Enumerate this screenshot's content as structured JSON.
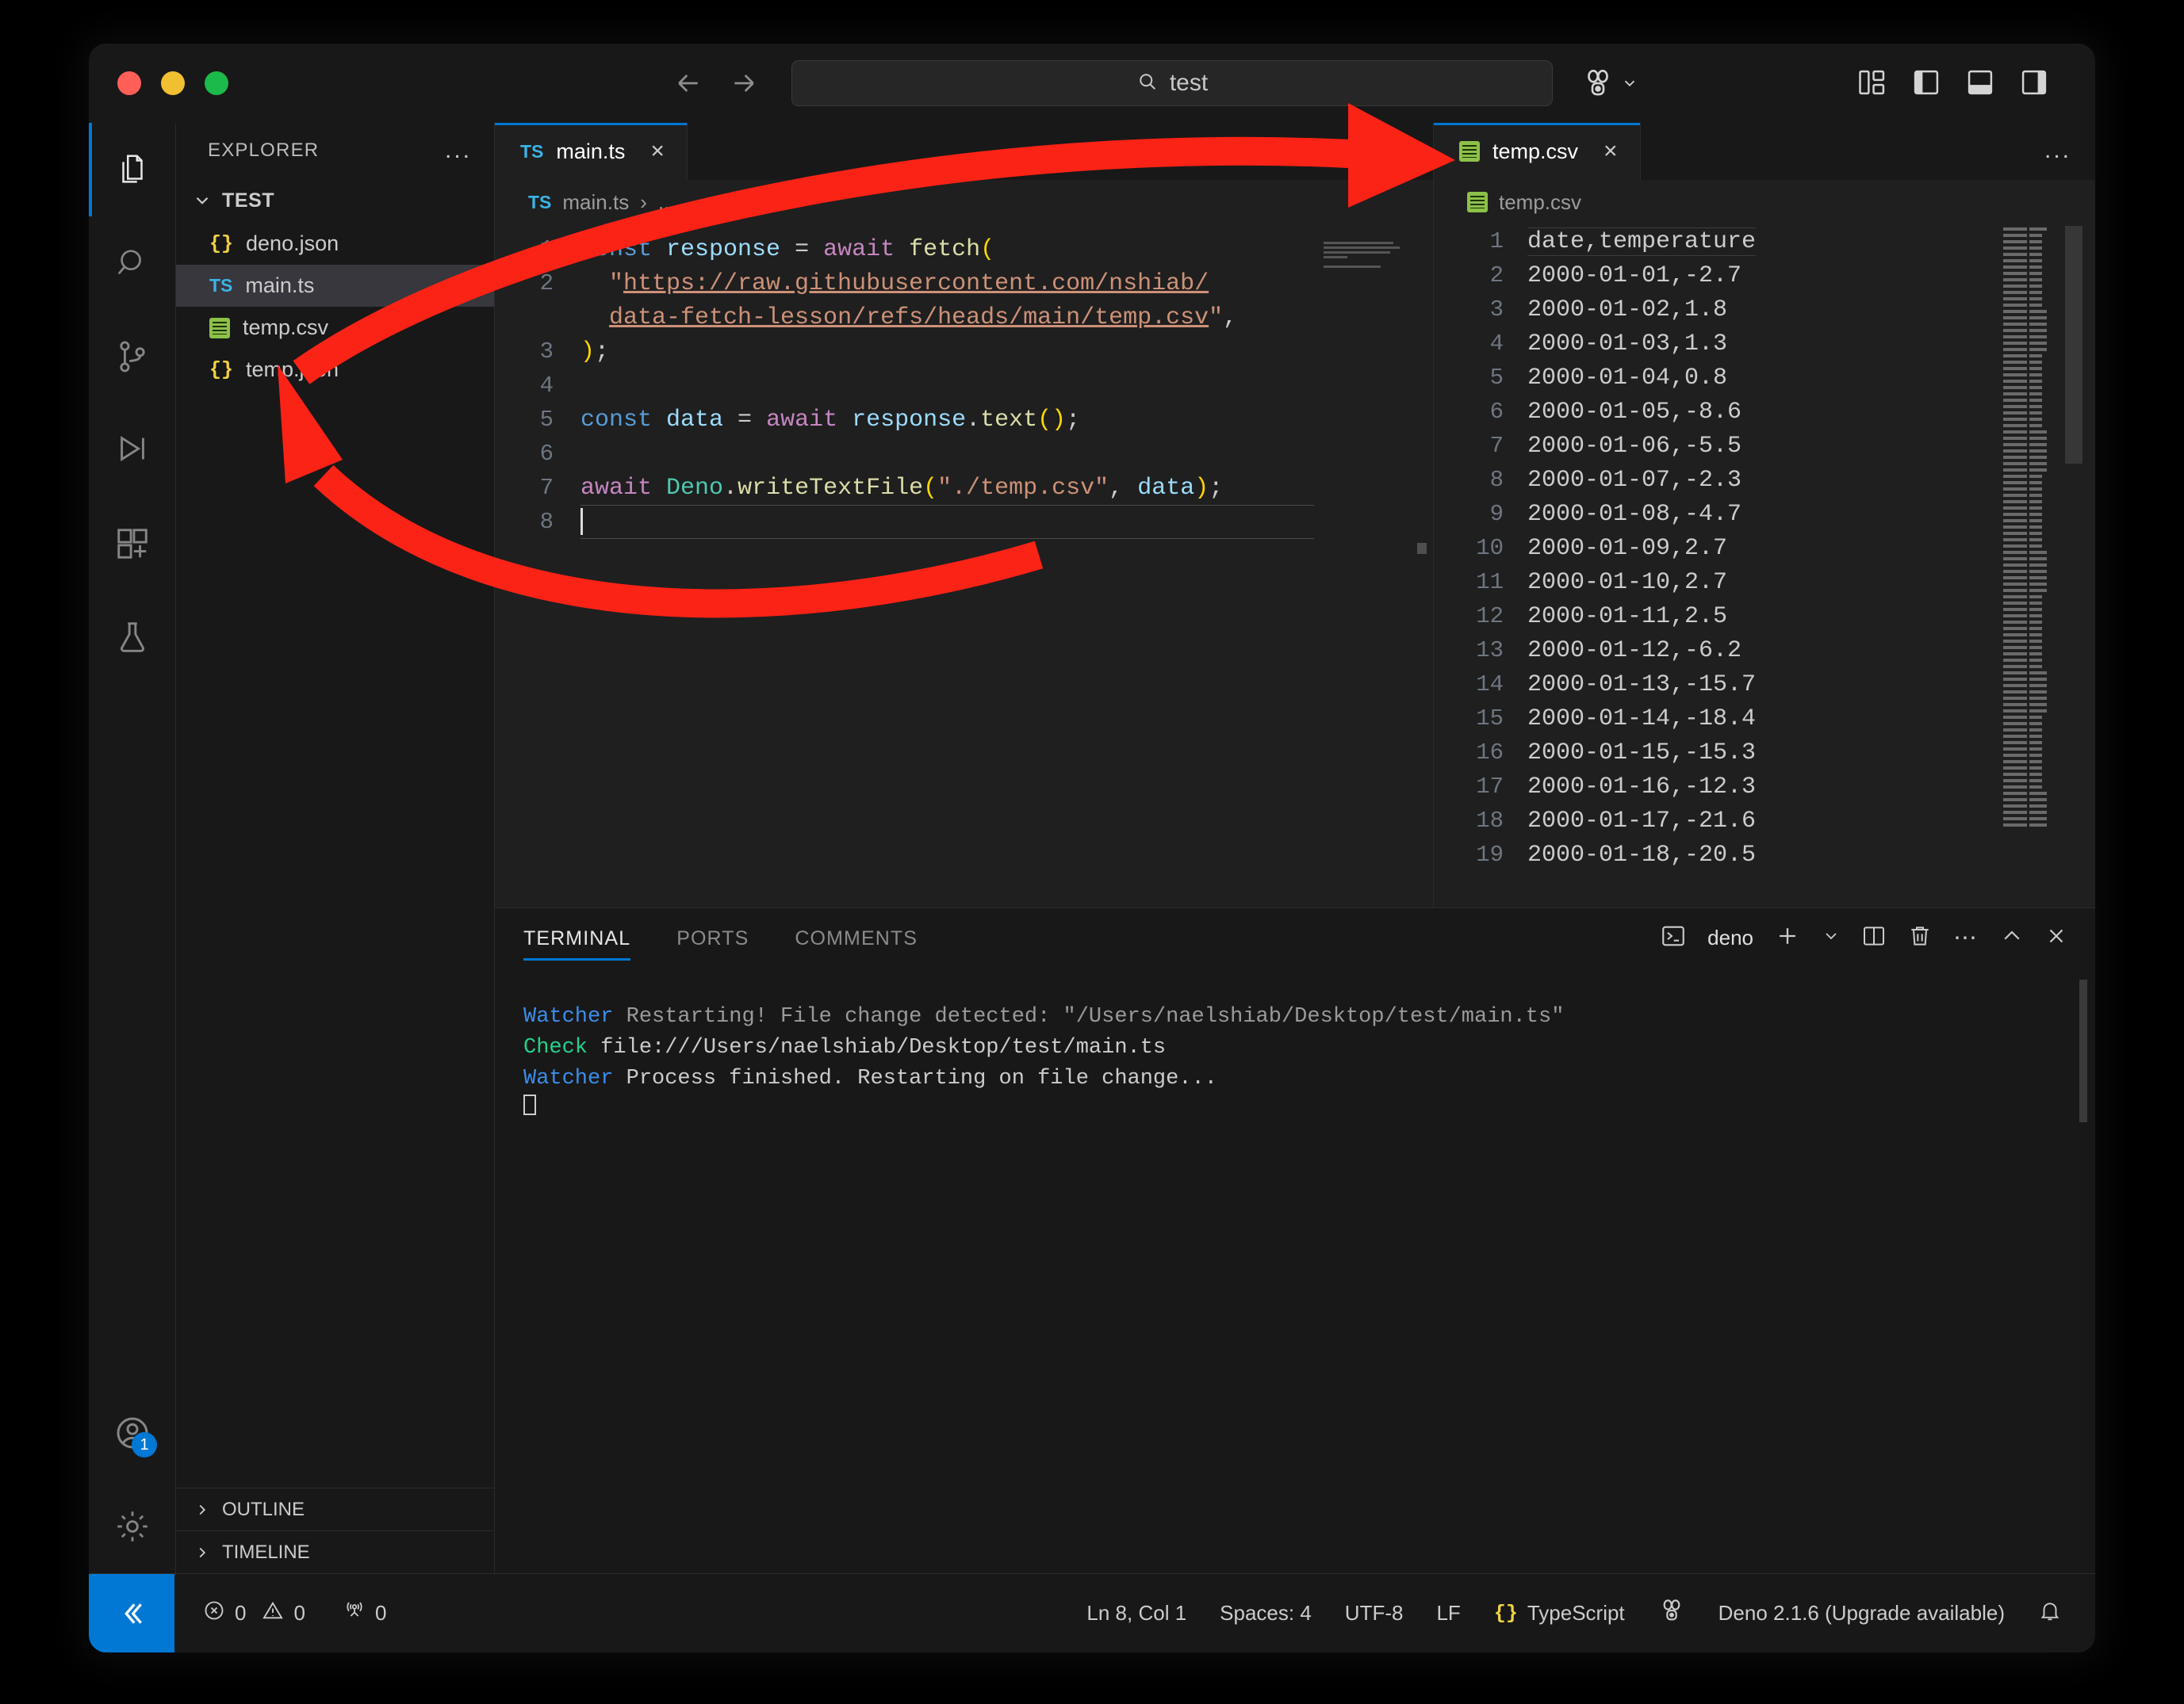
{
  "titlebar": {
    "search_value": "test",
    "search_icon": "search-icon",
    "back_icon": "arrow-left-icon",
    "forward_icon": "arrow-right-icon",
    "account_icon": "remote-explorer-icon",
    "layout_icons": [
      "customize-layout-icon",
      "toggle-primary-sidebar-icon",
      "toggle-panel-icon",
      "toggle-secondary-sidebar-icon"
    ]
  },
  "activitybar": {
    "items": [
      {
        "name": "explorer",
        "icon": "files-icon",
        "active": true
      },
      {
        "name": "search",
        "icon": "search-icon",
        "active": false
      },
      {
        "name": "source-control",
        "icon": "source-control-icon",
        "active": false
      },
      {
        "name": "run-and-debug",
        "icon": "run-debug-icon",
        "active": false
      },
      {
        "name": "extensions",
        "icon": "extensions-icon",
        "active": false
      },
      {
        "name": "testing",
        "icon": "beaker-icon",
        "active": false
      }
    ],
    "bottom": [
      {
        "name": "accounts",
        "icon": "account-icon",
        "badge": "1"
      },
      {
        "name": "manage",
        "icon": "gear-icon",
        "badge": ""
      }
    ]
  },
  "sidebar": {
    "title": "EXPLORER",
    "more_label": "...",
    "section": "TEST",
    "files": [
      {
        "name": "deno.json",
        "icon": "json-icon",
        "selected": false
      },
      {
        "name": "main.ts",
        "icon": "typescript-icon",
        "selected": true
      },
      {
        "name": "temp.csv",
        "icon": "csv-icon",
        "selected": false
      },
      {
        "name": "temp.json",
        "icon": "json-icon",
        "selected": false
      }
    ],
    "panels": [
      {
        "label": "OUTLINE"
      },
      {
        "label": "TIMELINE"
      }
    ]
  },
  "editor_main": {
    "tab": {
      "label": "main.ts",
      "icon": "typescript-icon",
      "close": "×"
    },
    "tabbar_action_icon": "open-changes-icon",
    "breadcrumb": {
      "file": "main.ts",
      "separator": "›",
      "tail": "..."
    },
    "lines": [
      {
        "no": "1",
        "segments": [
          {
            "t": "const ",
            "c": "k-kw"
          },
          {
            "t": "response ",
            "c": "k-var"
          },
          {
            "t": "= ",
            "c": "k-plain"
          },
          {
            "t": "await ",
            "c": "k-await"
          },
          {
            "t": "fetch",
            "c": "k-fn"
          },
          {
            "t": "(",
            "c": "k-paren"
          }
        ]
      },
      {
        "no": "2",
        "segments": [
          {
            "t": "  \"",
            "c": "k-str"
          },
          {
            "t": "https://raw.githubusercontent.com/nshiab/",
            "c": "k-link"
          }
        ]
      },
      {
        "no": "",
        "segments": [
          {
            "t": "  ",
            "c": "k-plain"
          },
          {
            "t": "data-fetch-lesson/refs/heads/main/temp.csv",
            "c": "k-link"
          },
          {
            "t": "\"",
            "c": "k-str"
          },
          {
            "t": ",",
            "c": "k-plain"
          }
        ]
      },
      {
        "no": "3",
        "segments": [
          {
            "t": ")",
            "c": "k-paren"
          },
          {
            "t": ";",
            "c": "k-plain"
          }
        ]
      },
      {
        "no": "4",
        "segments": []
      },
      {
        "no": "5",
        "segments": [
          {
            "t": "const ",
            "c": "k-kw"
          },
          {
            "t": "data ",
            "c": "k-var"
          },
          {
            "t": "= ",
            "c": "k-plain"
          },
          {
            "t": "await ",
            "c": "k-await"
          },
          {
            "t": "response",
            "c": "k-var"
          },
          {
            "t": ".",
            "c": "k-plain"
          },
          {
            "t": "text",
            "c": "k-fn"
          },
          {
            "t": "()",
            "c": "k-paren"
          },
          {
            "t": ";",
            "c": "k-plain"
          }
        ]
      },
      {
        "no": "6",
        "segments": []
      },
      {
        "no": "7",
        "segments": [
          {
            "t": "await ",
            "c": "k-await"
          },
          {
            "t": "Deno",
            "c": "k-ns"
          },
          {
            "t": ".",
            "c": "k-plain"
          },
          {
            "t": "writeTextFile",
            "c": "k-fn"
          },
          {
            "t": "(",
            "c": "k-paren"
          },
          {
            "t": "\"./temp.csv\"",
            "c": "k-str"
          },
          {
            "t": ", ",
            "c": "k-plain"
          },
          {
            "t": "data",
            "c": "k-var"
          },
          {
            "t": ")",
            "c": "k-paren"
          },
          {
            "t": ";",
            "c": "k-plain"
          }
        ]
      },
      {
        "no": "8",
        "segments": [],
        "cursor": true
      }
    ]
  },
  "editor_csv": {
    "tab": {
      "label": "temp.csv",
      "icon": "csv-icon",
      "close": "×"
    },
    "more_label": "...",
    "breadcrumb": {
      "file": "temp.csv",
      "icon": "csv-icon"
    },
    "lines": [
      {
        "no": "1",
        "text": "date,temperature"
      },
      {
        "no": "2",
        "text": "2000-01-01,-2.7"
      },
      {
        "no": "3",
        "text": "2000-01-02,1.8"
      },
      {
        "no": "4",
        "text": "2000-01-03,1.3"
      },
      {
        "no": "5",
        "text": "2000-01-04,0.8"
      },
      {
        "no": "6",
        "text": "2000-01-05,-8.6"
      },
      {
        "no": "7",
        "text": "2000-01-06,-5.5"
      },
      {
        "no": "8",
        "text": "2000-01-07,-2.3"
      },
      {
        "no": "9",
        "text": "2000-01-08,-4.7"
      },
      {
        "no": "10",
        "text": "2000-01-09,2.7"
      },
      {
        "no": "11",
        "text": "2000-01-10,2.7"
      },
      {
        "no": "12",
        "text": "2000-01-11,2.5"
      },
      {
        "no": "13",
        "text": "2000-01-12,-6.2"
      },
      {
        "no": "14",
        "text": "2000-01-13,-15.7"
      },
      {
        "no": "15",
        "text": "2000-01-14,-18.4"
      },
      {
        "no": "16",
        "text": "2000-01-15,-15.3"
      },
      {
        "no": "17",
        "text": "2000-01-16,-12.3"
      },
      {
        "no": "18",
        "text": "2000-01-17,-21.6"
      },
      {
        "no": "19",
        "text": "2000-01-18,-20.5"
      }
    ]
  },
  "panel": {
    "tabs": [
      {
        "label": "TERMINAL",
        "active": true
      },
      {
        "label": "PORTS",
        "active": false
      },
      {
        "label": "COMMENTS",
        "active": false
      }
    ],
    "actions": {
      "shell_label": "deno",
      "shell_icon": "terminal-icon",
      "new_icon": "plus-icon",
      "dropdown_icon": "chevron-down-icon",
      "split_icon": "split-editor-icon",
      "kill_icon": "trash-icon",
      "more_icon": "more-icon",
      "maximize_icon": "chevron-up-icon",
      "close_icon": "close-icon"
    },
    "terminal_lines": [
      [
        {
          "t": "Watcher",
          "c": "t-watcher"
        },
        {
          "t": " Restarting! File change detected: \"/Users/naelshiab/Desktop/test/main.ts\"",
          "c": "t-grey"
        }
      ],
      [
        {
          "t": "Check",
          "c": "t-check"
        },
        {
          "t": " file:///Users/naelshiab/Desktop/test/main.ts",
          "c": "t-white"
        }
      ],
      [
        {
          "t": "Watcher",
          "c": "t-watcher"
        },
        {
          "t": " Process finished. Restarting on file change...",
          "c": "t-white"
        }
      ]
    ]
  },
  "statusbar": {
    "remote_icon": "remote-window-icon",
    "errors": {
      "icon": "error-icon",
      "count": "0"
    },
    "warnings": {
      "icon": "warning-icon",
      "count": "0"
    },
    "ports": {
      "icon": "radio-tower-icon",
      "count": "0"
    },
    "position": "Ln 8, Col 1",
    "indentation": "Spaces: 4",
    "encoding": "UTF-8",
    "eol": "LF",
    "language": "TypeScript",
    "language_icon": "json-brackets-icon",
    "deno_icon": "deno-icon",
    "deno_version": "Deno 2.1.6 (Upgrade available)",
    "bell_icon": "bell-icon"
  },
  "annotations": {
    "arrow_color": "#fb2216",
    "arrow_1": "arrow-from-code-to-csv-tab",
    "arrow_2": "arrow-from-terminal-to-temp-csv-file"
  }
}
